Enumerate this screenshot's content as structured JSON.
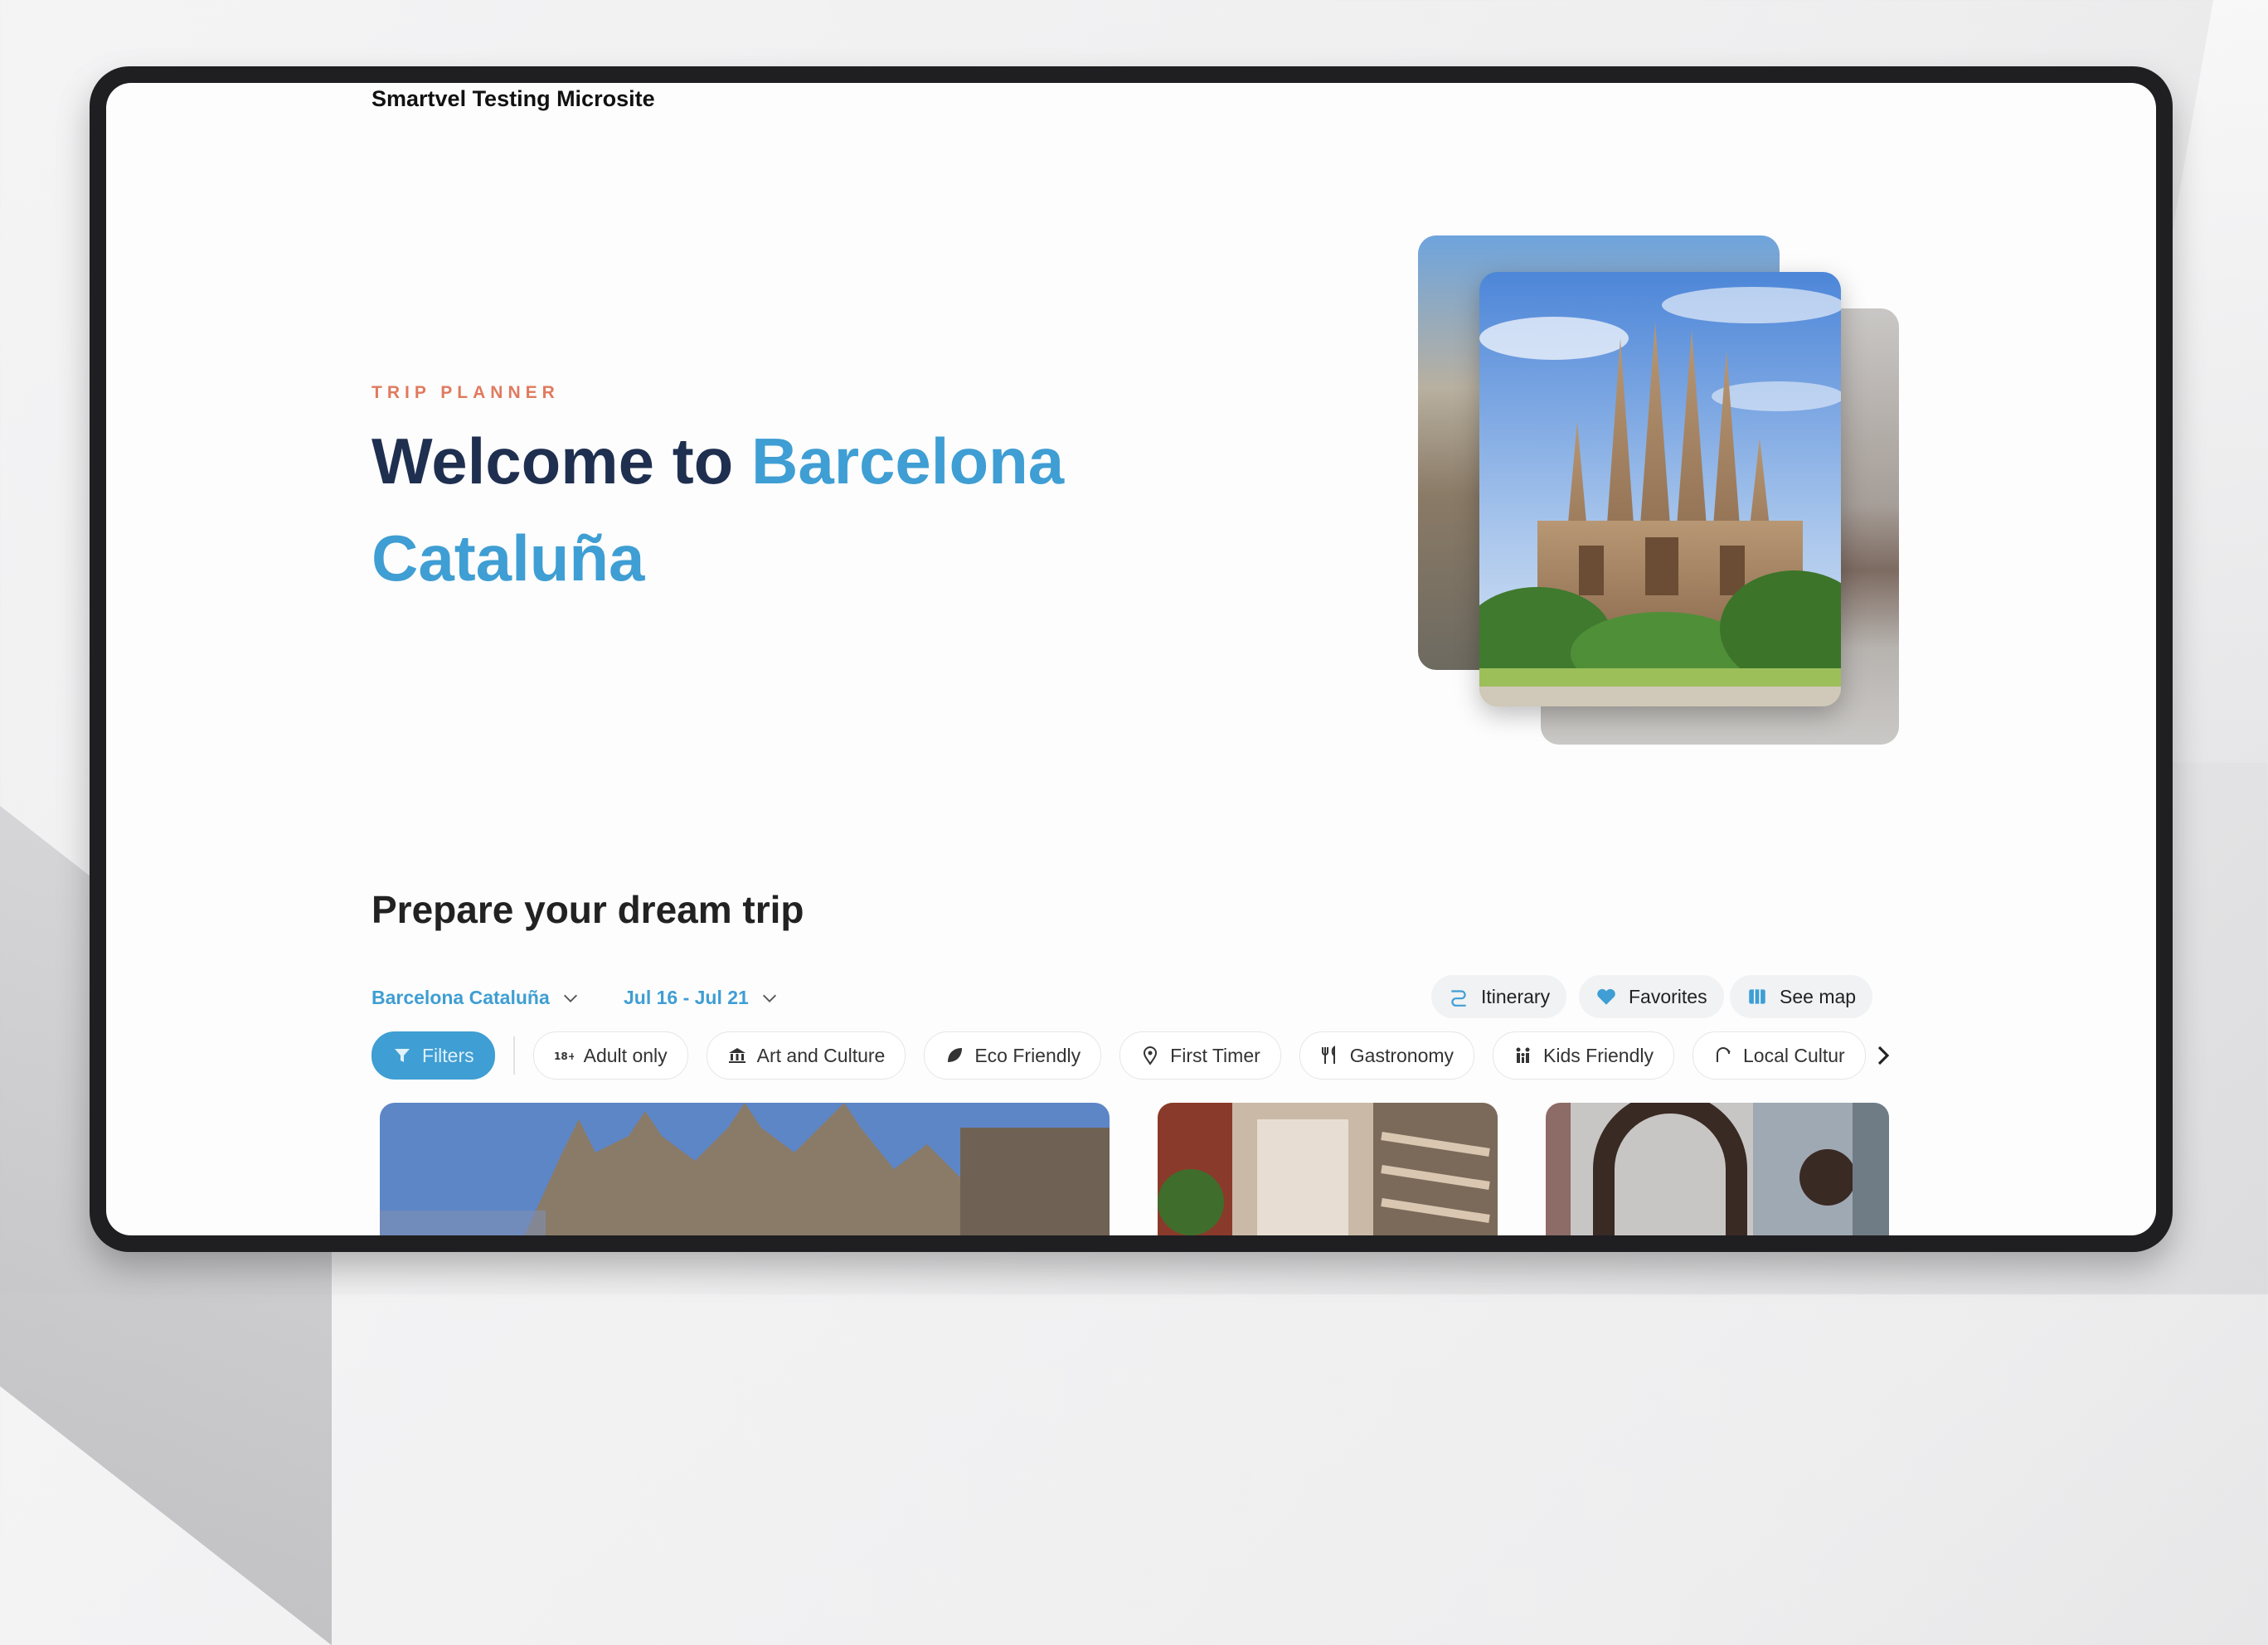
{
  "site": {
    "title": "Smartvel Testing Microsite"
  },
  "hero": {
    "eyebrow": "TRIP PLANNER",
    "title_prefix": "Welcome to ",
    "title_accent": "Barcelona Cataluña"
  },
  "planner": {
    "heading": "Prepare your dream trip",
    "destination": "Barcelona Cataluña",
    "dates": "Jul 16 - Jul 21",
    "actions": {
      "itinerary": "Itinerary",
      "favorites": "Favorites",
      "see_map": "See map"
    },
    "filter_button": "Filters",
    "categories": [
      {
        "label": "Adult only",
        "icon": "adult-only-18-icon"
      },
      {
        "label": "Art and Culture",
        "icon": "museum-icon"
      },
      {
        "label": "Eco Friendly",
        "icon": "leaf-icon"
      },
      {
        "label": "First Timer",
        "icon": "location-pin-icon"
      },
      {
        "label": "Gastronomy",
        "icon": "fork-knife-icon"
      },
      {
        "label": "Kids Friendly",
        "icon": "family-icon"
      },
      {
        "label": "Local Cultur",
        "icon": "local-culture-icon"
      }
    ]
  },
  "colors": {
    "accent": "#3f9ed3",
    "eyebrow": "#e07a5f",
    "heading_dark": "#1f2f50"
  }
}
